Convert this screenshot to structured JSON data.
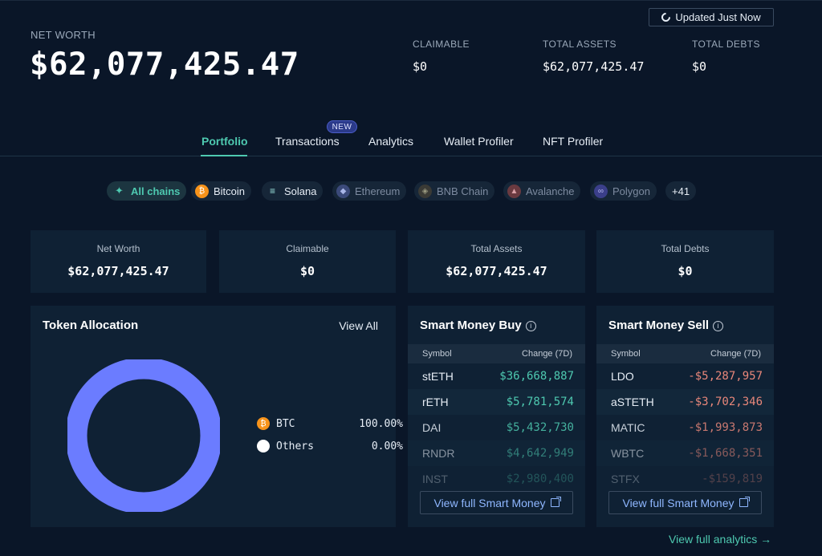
{
  "header": {
    "net_worth_label": "NET WORTH",
    "net_worth_value": "$62,077,425.47",
    "updated_label": "Updated Just Now",
    "summary": [
      {
        "label": "CLAIMABLE",
        "value": "$0"
      },
      {
        "label": "TOTAL ASSETS",
        "value": "$62,077,425.47"
      },
      {
        "label": "TOTAL DEBTS",
        "value": "$0"
      }
    ]
  },
  "tabs": {
    "items": [
      "Portfolio",
      "Transactions",
      "Analytics",
      "Wallet Profiler",
      "NFT Profiler"
    ],
    "active": "Portfolio",
    "new_badge": "NEW"
  },
  "chains": {
    "items": [
      {
        "label": "All chains",
        "icon": "all-chains-icon",
        "state": "active"
      },
      {
        "label": "Bitcoin",
        "icon": "bitcoin-icon",
        "state": "enabled"
      },
      {
        "label": "Solana",
        "icon": "solana-icon",
        "state": "enabled"
      },
      {
        "label": "Ethereum",
        "icon": "ethereum-icon",
        "state": "disabled"
      },
      {
        "label": "BNB Chain",
        "icon": "bnb-icon",
        "state": "disabled"
      },
      {
        "label": "Avalanche",
        "icon": "avalanche-icon",
        "state": "disabled"
      },
      {
        "label": "Polygon",
        "icon": "polygon-icon",
        "state": "disabled"
      }
    ],
    "more": "+41"
  },
  "stats": [
    {
      "label": "Net Worth",
      "value": "$62,077,425.47"
    },
    {
      "label": "Claimable",
      "value": "$0"
    },
    {
      "label": "Total Assets",
      "value": "$62,077,425.47"
    },
    {
      "label": "Total Debts",
      "value": "$0"
    }
  ],
  "allocation": {
    "title": "Token Allocation",
    "view_all": "View All",
    "ring_color": "#6b7cff",
    "legend": [
      {
        "name": "BTC",
        "pct": "100.00%",
        "share": 1.0,
        "color": "#f7931a"
      },
      {
        "name": "Others",
        "pct": "0.00%",
        "share": 0.0,
        "color": "#ffffff"
      }
    ]
  },
  "smart_buy": {
    "title": "Smart Money Buy",
    "col_symbol": "Symbol",
    "col_change": "Change (7D)",
    "rows": [
      {
        "symbol": "stETH",
        "change": "$36,668,887"
      },
      {
        "symbol": "rETH",
        "change": "$5,781,574"
      },
      {
        "symbol": "DAI",
        "change": "$5,432,730"
      },
      {
        "symbol": "RNDR",
        "change": "$4,642,949"
      },
      {
        "symbol": "INST",
        "change": "$2,980,400"
      }
    ],
    "button": "View full Smart Money",
    "color": "#4ec9b0"
  },
  "smart_sell": {
    "title": "Smart Money Sell",
    "col_symbol": "Symbol",
    "col_change": "Change (7D)",
    "rows": [
      {
        "symbol": "LDO",
        "change": "-$5,287,957"
      },
      {
        "symbol": "aSTETH",
        "change": "-$3,702,346"
      },
      {
        "symbol": "MATIC",
        "change": "-$1,993,873"
      },
      {
        "symbol": "WBTC",
        "change": "-$1,668,351"
      },
      {
        "symbol": "STFX",
        "change": "-$159,819"
      }
    ],
    "button": "View full Smart Money",
    "color": "#e8877a"
  },
  "footer": {
    "analytics_link": "View full analytics →"
  }
}
